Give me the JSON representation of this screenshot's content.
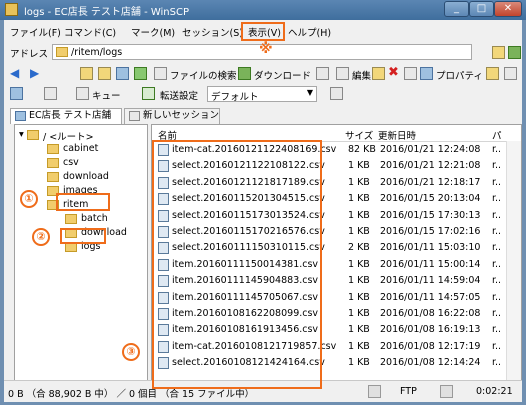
{
  "window": {
    "title": "logs - EC店長 テスト店舗 - WinSCP",
    "minimize": "_",
    "maximize": "□",
    "close": "✕"
  },
  "menu": [
    "ファイル(F)",
    "コマンド(C)",
    "マーク(M)",
    "セッション(S)",
    "表示(V)",
    "ヘルプ(H)"
  ],
  "annotation_mark": "※",
  "address": {
    "label": "アドレス",
    "path": "/ritem/logs"
  },
  "toolbar1": {
    "find_files": "ファイルの検索",
    "download": "ダウンロード",
    "edit": "編集",
    "properties": "プロパティ"
  },
  "toolbar2": {
    "queue": "キュー",
    "transfer_settings": "転送設定",
    "preset": "デフォルト"
  },
  "tabs": {
    "session": "EC店長 テスト店舗",
    "new_session": "新しいセッション"
  },
  "tree": [
    {
      "label": "/ <ルート>"
    },
    {
      "label": "cabinet"
    },
    {
      "label": "csv"
    },
    {
      "label": "download"
    },
    {
      "label": "images"
    },
    {
      "label": "ritem"
    },
    {
      "label": "batch"
    },
    {
      "label": "download"
    },
    {
      "label": "logs"
    }
  ],
  "columns": {
    "name": "名前",
    "size": "サイズ",
    "modified": "更新日時",
    "perm": "パ"
  },
  "files": [
    {
      "name": "item-cat.20160121122408169.csv",
      "size": "82 KB",
      "date": "2016/01/21 12:24:08",
      "perm": "r.."
    },
    {
      "name": "select.20160121122108122.csv",
      "size": "1 KB",
      "date": "2016/01/21 12:21:08",
      "perm": "r.."
    },
    {
      "name": "select.20160121121817189.csv",
      "size": "1 KB",
      "date": "2016/01/21 12:18:17",
      "perm": "r.."
    },
    {
      "name": "select.20160115201304515.csv",
      "size": "1 KB",
      "date": "2016/01/15 20:13:04",
      "perm": "r.."
    },
    {
      "name": "select.20160115173013524.csv",
      "size": "1 KB",
      "date": "2016/01/15 17:30:13",
      "perm": "r.."
    },
    {
      "name": "select.20160115170216576.csv",
      "size": "1 KB",
      "date": "2016/01/15 17:02:16",
      "perm": "r.."
    },
    {
      "name": "select.20160111150310115.csv",
      "size": "2 KB",
      "date": "2016/01/11 15:03:10",
      "perm": "r.."
    },
    {
      "name": "item.20160111150014381.csv",
      "size": "1 KB",
      "date": "2016/01/11 15:00:14",
      "perm": "r.."
    },
    {
      "name": "item.20160111145904883.csv",
      "size": "1 KB",
      "date": "2016/01/11 14:59:04",
      "perm": "r.."
    },
    {
      "name": "item.20160111145705067.csv",
      "size": "1 KB",
      "date": "2016/01/11 14:57:05",
      "perm": "r.."
    },
    {
      "name": "item.20160108162208099.csv",
      "size": "1 KB",
      "date": "2016/01/08 16:22:08",
      "perm": "r.."
    },
    {
      "name": "item.20160108161913456.csv",
      "size": "1 KB",
      "date": "2016/01/08 16:19:13",
      "perm": "r.."
    },
    {
      "name": "item-cat.20160108121719857.csv",
      "size": "1 KB",
      "date": "2016/01/08 12:17:19",
      "perm": "r.."
    },
    {
      "name": "select.20160108121424164.csv",
      "size": "1 KB",
      "date": "2016/01/08 12:14:24",
      "perm": "r.."
    }
  ],
  "status": {
    "size_info": "0 B （合 88,902 B 中） ／ 0 個目 （合 15 ファイル中）",
    "protocol": "FTP",
    "time": "0:02:21"
  },
  "badges": [
    "①",
    "②",
    "③"
  ]
}
